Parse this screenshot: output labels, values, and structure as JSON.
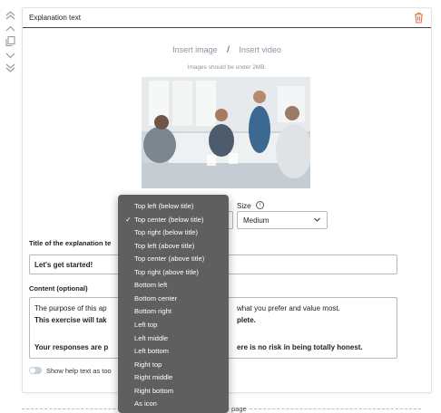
{
  "card": {
    "title": "Explanation text"
  },
  "media": {
    "insert_image": "Insert image",
    "separator": "/",
    "insert_video": "Insert video",
    "size_hint": "Images should be under 2MB."
  },
  "image_settings": {
    "size_label": "Size",
    "size_value": "Medium",
    "position_options": [
      "Top left (below title)",
      "Top center (below title)",
      "Top right (below title)",
      "Top left (above title)",
      "Top center (above title)",
      "Top right (above title)",
      "Bottom left",
      "Bottom center",
      "Bottom right",
      "Left top",
      "Left middle",
      "Left bottom",
      "Right top",
      "Right middle",
      "Right bottom",
      "As icon"
    ],
    "selected_position": "Top center (below title)",
    "check_mark": "✓"
  },
  "title_field": {
    "label_visible": "Title of the explanation te",
    "value": "Let's get started!"
  },
  "content_field": {
    "label": "Content (optional)",
    "line1_left": "The purpose of this ap",
    "line1_right": "what you prefer and value most.",
    "line2_left": "This exercise will tak",
    "line2_right": "plete.",
    "line3_left": "Your responses are p",
    "line3_right": "ere is no risk in being totally honest."
  },
  "help_toggle": {
    "label": "Show help text as too"
  },
  "footer": {
    "text": "page"
  },
  "colors": {
    "accent_trash": "#e8734a",
    "dropdown_bg": "#585858",
    "muted_link": "#8a94a0"
  }
}
